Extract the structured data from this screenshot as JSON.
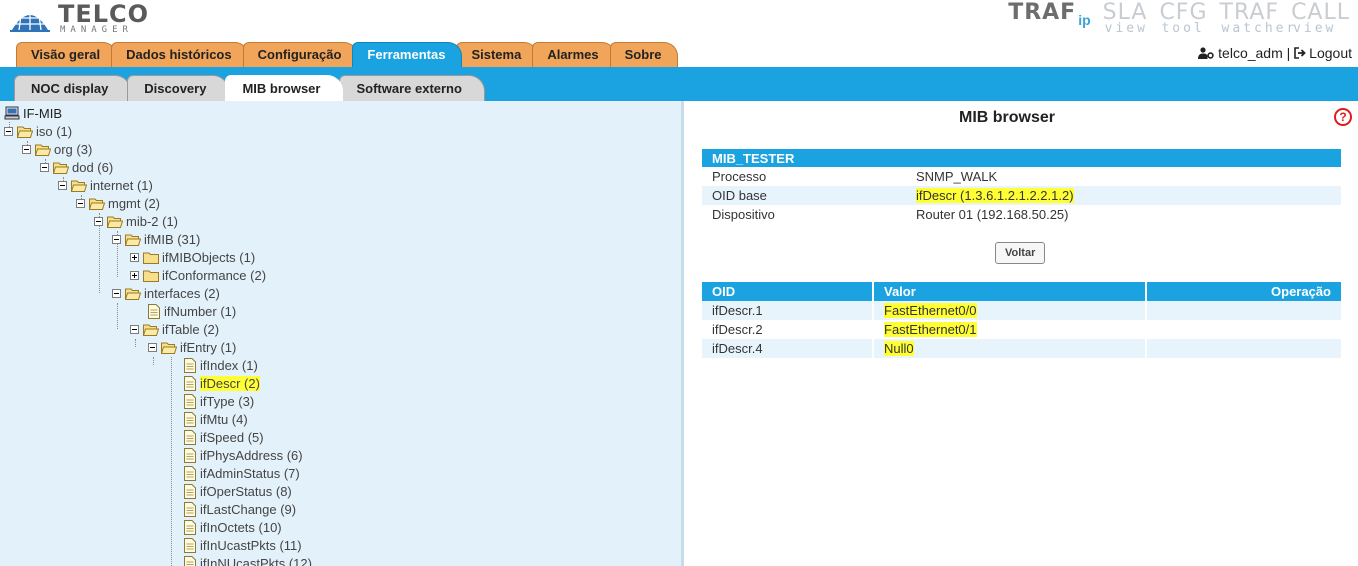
{
  "brand": {
    "name": "TELCO",
    "sub": "MANAGER"
  },
  "products": [
    {
      "main": "TRAF",
      "badge": "ip",
      "sub": ""
    },
    {
      "main": "SLA",
      "sub": "view"
    },
    {
      "main": "CFG",
      "sub": "tool"
    },
    {
      "main": "TRAF",
      "sub": "watcher"
    },
    {
      "main": "CALL",
      "sub": "view"
    }
  ],
  "topnav": {
    "tabs": [
      "Visão geral",
      "Dados históricos",
      "Configuração",
      "Ferramentas",
      "Sistema",
      "Alarmes",
      "Sobre"
    ],
    "active": "Ferramentas"
  },
  "user": {
    "name": "telco_adm",
    "separator": "|",
    "logout": "Logout"
  },
  "subnav": {
    "tabs": [
      "NOC display",
      "Discovery",
      "MIB browser",
      "Software externo"
    ],
    "active": "MIB browser"
  },
  "tree": {
    "root": "IF-MIB",
    "nodes": [
      {
        "label": "iso (1)",
        "type": "folder",
        "toggle": "minus"
      },
      {
        "label": "org (3)",
        "type": "folder",
        "toggle": "minus"
      },
      {
        "label": "dod (6)",
        "type": "folder",
        "toggle": "minus"
      },
      {
        "label": "internet (1)",
        "type": "folder",
        "toggle": "minus"
      },
      {
        "label": "mgmt (2)",
        "type": "folder",
        "toggle": "minus"
      },
      {
        "label": "mib-2 (1)",
        "type": "folder",
        "toggle": "minus"
      },
      {
        "label": "ifMIB (31)",
        "type": "folder",
        "toggle": "minus"
      },
      {
        "label": "ifMIBObjects (1)",
        "type": "folder",
        "toggle": "plus"
      },
      {
        "label": "ifConformance (2)",
        "type": "folder",
        "toggle": "plus"
      },
      {
        "label": "interfaces (2)",
        "type": "folder",
        "toggle": "minus"
      },
      {
        "label": "ifNumber (1)",
        "type": "doc"
      },
      {
        "label": "ifTable (2)",
        "type": "folder",
        "toggle": "minus"
      },
      {
        "label": "ifEntry (1)",
        "type": "folder",
        "toggle": "minus"
      },
      {
        "label": "ifIndex (1)",
        "type": "doc"
      },
      {
        "label": "ifDescr (2)",
        "type": "doc",
        "highlight": true
      },
      {
        "label": "ifType (3)",
        "type": "doc"
      },
      {
        "label": "ifMtu (4)",
        "type": "doc"
      },
      {
        "label": "ifSpeed (5)",
        "type": "doc"
      },
      {
        "label": "ifPhysAddress (6)",
        "type": "doc"
      },
      {
        "label": "ifAdminStatus (7)",
        "type": "doc"
      },
      {
        "label": "ifOperStatus (8)",
        "type": "doc"
      },
      {
        "label": "ifLastChange (9)",
        "type": "doc"
      },
      {
        "label": "ifInOctets (10)",
        "type": "doc"
      },
      {
        "label": "ifInUcastPkts (11)",
        "type": "doc"
      },
      {
        "label": "ifInNUcastPkts (12)",
        "type": "doc"
      }
    ]
  },
  "main": {
    "title": "MIB browser",
    "help": "?",
    "info": {
      "header": "MIB_TESTER",
      "rows": [
        {
          "key": "Processo",
          "value": "SNMP_WALK"
        },
        {
          "key": "OID base",
          "value": "ifDescr (1.3.6.1.2.1.2.2.1.2)"
        },
        {
          "key": "Dispositivo",
          "value": "Router 01 (192.168.50.25)"
        }
      ]
    },
    "back_button": "Voltar",
    "results": {
      "columns": [
        "OID",
        "Valor",
        "Operação"
      ],
      "rows": [
        {
          "oid": "ifDescr.1",
          "value": "FastEthernet0/0",
          "op": ""
        },
        {
          "oid": "ifDescr.2",
          "value": "FastEthernet0/1",
          "op": ""
        },
        {
          "oid": "ifDescr.4",
          "value": "Null0",
          "op": ""
        }
      ]
    }
  },
  "colors": {
    "accent": "#1aa3e0",
    "tab_orange": "#f0a55a",
    "tree_bg": "#e3f1fb",
    "highlight": "#ffff33"
  }
}
